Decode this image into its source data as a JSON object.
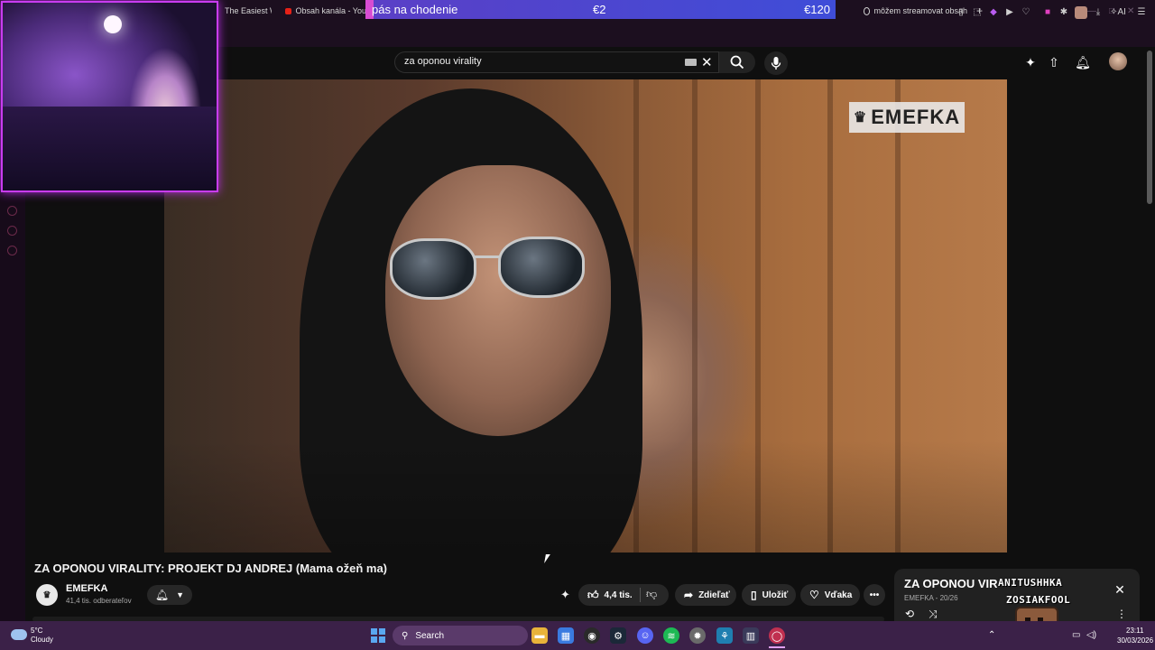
{
  "browser": {
    "tabs": [
      {
        "label": "The Easiest W"
      },
      {
        "label": "Obsah kanála - You"
      },
      {
        "label": "môžem streamovat obsah"
      }
    ],
    "new_tab_label": "+"
  },
  "donation_goal": {
    "label": "pás na chodenie",
    "current": "€2",
    "target": "€120",
    "progress": 0.017
  },
  "youtube": {
    "search": {
      "value": "za oponou virality"
    },
    "video": {
      "brand_overlay": "EMEFKA",
      "title": "ZA OPONOU VIRALITY: PROJEKT DJ ANDREJ (Mama ožeň ma)"
    },
    "channel": {
      "name": "EMEFKA",
      "subscribers": "41,4 tis. odberateľov"
    },
    "actions": {
      "likes": "4,4 tis.",
      "share": "Zdieľať",
      "save": "Uložiť",
      "thanks": "Vďaka"
    }
  },
  "miniplayer": {
    "title": "ZA OPONOU VIR",
    "meta": "EMEFKA - 20/26"
  },
  "stream_overlay": {
    "line1": "ANITUSHHKA",
    "line2": "ZOSIAKFOOL"
  },
  "taskbar": {
    "weather_temp": "5°C",
    "weather_desc": "Cloudy",
    "search_label": "Search",
    "time": "23:11",
    "date": "30/03/2026"
  },
  "colors": {
    "accent_purple": "#c93cf0",
    "taskbar": "#3b2148",
    "youtube_red": "#e62117"
  }
}
